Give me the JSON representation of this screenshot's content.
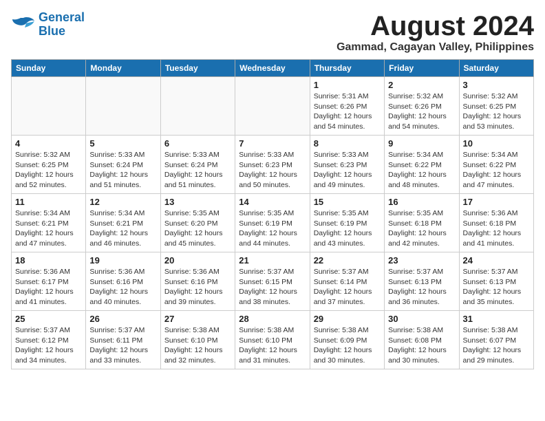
{
  "logo": {
    "line1": "General",
    "line2": "Blue"
  },
  "title": "August 2024",
  "subtitle": "Gammad, Cagayan Valley, Philippines",
  "weekdays": [
    "Sunday",
    "Monday",
    "Tuesday",
    "Wednesday",
    "Thursday",
    "Friday",
    "Saturday"
  ],
  "weeks": [
    [
      {
        "day": "",
        "info": ""
      },
      {
        "day": "",
        "info": ""
      },
      {
        "day": "",
        "info": ""
      },
      {
        "day": "",
        "info": ""
      },
      {
        "day": "1",
        "info": "Sunrise: 5:31 AM\nSunset: 6:26 PM\nDaylight: 12 hours\nand 54 minutes."
      },
      {
        "day": "2",
        "info": "Sunrise: 5:32 AM\nSunset: 6:26 PM\nDaylight: 12 hours\nand 54 minutes."
      },
      {
        "day": "3",
        "info": "Sunrise: 5:32 AM\nSunset: 6:25 PM\nDaylight: 12 hours\nand 53 minutes."
      }
    ],
    [
      {
        "day": "4",
        "info": "Sunrise: 5:32 AM\nSunset: 6:25 PM\nDaylight: 12 hours\nand 52 minutes."
      },
      {
        "day": "5",
        "info": "Sunrise: 5:33 AM\nSunset: 6:24 PM\nDaylight: 12 hours\nand 51 minutes."
      },
      {
        "day": "6",
        "info": "Sunrise: 5:33 AM\nSunset: 6:24 PM\nDaylight: 12 hours\nand 51 minutes."
      },
      {
        "day": "7",
        "info": "Sunrise: 5:33 AM\nSunset: 6:23 PM\nDaylight: 12 hours\nand 50 minutes."
      },
      {
        "day": "8",
        "info": "Sunrise: 5:33 AM\nSunset: 6:23 PM\nDaylight: 12 hours\nand 49 minutes."
      },
      {
        "day": "9",
        "info": "Sunrise: 5:34 AM\nSunset: 6:22 PM\nDaylight: 12 hours\nand 48 minutes."
      },
      {
        "day": "10",
        "info": "Sunrise: 5:34 AM\nSunset: 6:22 PM\nDaylight: 12 hours\nand 47 minutes."
      }
    ],
    [
      {
        "day": "11",
        "info": "Sunrise: 5:34 AM\nSunset: 6:21 PM\nDaylight: 12 hours\nand 47 minutes."
      },
      {
        "day": "12",
        "info": "Sunrise: 5:34 AM\nSunset: 6:21 PM\nDaylight: 12 hours\nand 46 minutes."
      },
      {
        "day": "13",
        "info": "Sunrise: 5:35 AM\nSunset: 6:20 PM\nDaylight: 12 hours\nand 45 minutes."
      },
      {
        "day": "14",
        "info": "Sunrise: 5:35 AM\nSunset: 6:19 PM\nDaylight: 12 hours\nand 44 minutes."
      },
      {
        "day": "15",
        "info": "Sunrise: 5:35 AM\nSunset: 6:19 PM\nDaylight: 12 hours\nand 43 minutes."
      },
      {
        "day": "16",
        "info": "Sunrise: 5:35 AM\nSunset: 6:18 PM\nDaylight: 12 hours\nand 42 minutes."
      },
      {
        "day": "17",
        "info": "Sunrise: 5:36 AM\nSunset: 6:18 PM\nDaylight: 12 hours\nand 41 minutes."
      }
    ],
    [
      {
        "day": "18",
        "info": "Sunrise: 5:36 AM\nSunset: 6:17 PM\nDaylight: 12 hours\nand 41 minutes."
      },
      {
        "day": "19",
        "info": "Sunrise: 5:36 AM\nSunset: 6:16 PM\nDaylight: 12 hours\nand 40 minutes."
      },
      {
        "day": "20",
        "info": "Sunrise: 5:36 AM\nSunset: 6:16 PM\nDaylight: 12 hours\nand 39 minutes."
      },
      {
        "day": "21",
        "info": "Sunrise: 5:37 AM\nSunset: 6:15 PM\nDaylight: 12 hours\nand 38 minutes."
      },
      {
        "day": "22",
        "info": "Sunrise: 5:37 AM\nSunset: 6:14 PM\nDaylight: 12 hours\nand 37 minutes."
      },
      {
        "day": "23",
        "info": "Sunrise: 5:37 AM\nSunset: 6:13 PM\nDaylight: 12 hours\nand 36 minutes."
      },
      {
        "day": "24",
        "info": "Sunrise: 5:37 AM\nSunset: 6:13 PM\nDaylight: 12 hours\nand 35 minutes."
      }
    ],
    [
      {
        "day": "25",
        "info": "Sunrise: 5:37 AM\nSunset: 6:12 PM\nDaylight: 12 hours\nand 34 minutes."
      },
      {
        "day": "26",
        "info": "Sunrise: 5:37 AM\nSunset: 6:11 PM\nDaylight: 12 hours\nand 33 minutes."
      },
      {
        "day": "27",
        "info": "Sunrise: 5:38 AM\nSunset: 6:10 PM\nDaylight: 12 hours\nand 32 minutes."
      },
      {
        "day": "28",
        "info": "Sunrise: 5:38 AM\nSunset: 6:10 PM\nDaylight: 12 hours\nand 31 minutes."
      },
      {
        "day": "29",
        "info": "Sunrise: 5:38 AM\nSunset: 6:09 PM\nDaylight: 12 hours\nand 30 minutes."
      },
      {
        "day": "30",
        "info": "Sunrise: 5:38 AM\nSunset: 6:08 PM\nDaylight: 12 hours\nand 30 minutes."
      },
      {
        "day": "31",
        "info": "Sunrise: 5:38 AM\nSunset: 6:07 PM\nDaylight: 12 hours\nand 29 minutes."
      }
    ]
  ]
}
